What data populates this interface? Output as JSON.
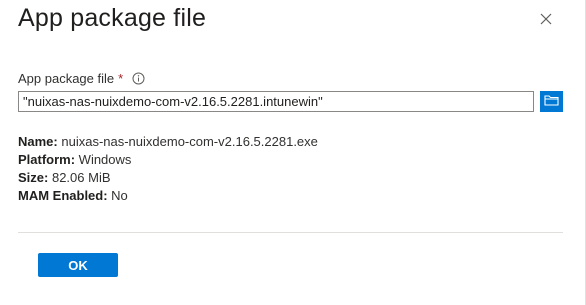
{
  "dialog": {
    "title": "App package file"
  },
  "field": {
    "label": "App package file",
    "required_mark": "*",
    "value": "\"nuixas-nas-nuixdemo-com-v2.16.5.2281.intunewin\""
  },
  "details": {
    "name_label": "Name:",
    "name_value": "nuixas-nas-nuixdemo-com-v2.16.5.2281.exe",
    "platform_label": "Platform:",
    "platform_value": "Windows",
    "size_label": "Size:",
    "size_value": "82.06 MiB",
    "mam_label": "MAM Enabled:",
    "mam_value": "No"
  },
  "footer": {
    "ok_label": "OK"
  },
  "colors": {
    "accent": "#0078d4",
    "required": "#a4262c"
  },
  "icons": {
    "close": "close-icon",
    "info": "info-icon",
    "browse": "folder-icon"
  }
}
